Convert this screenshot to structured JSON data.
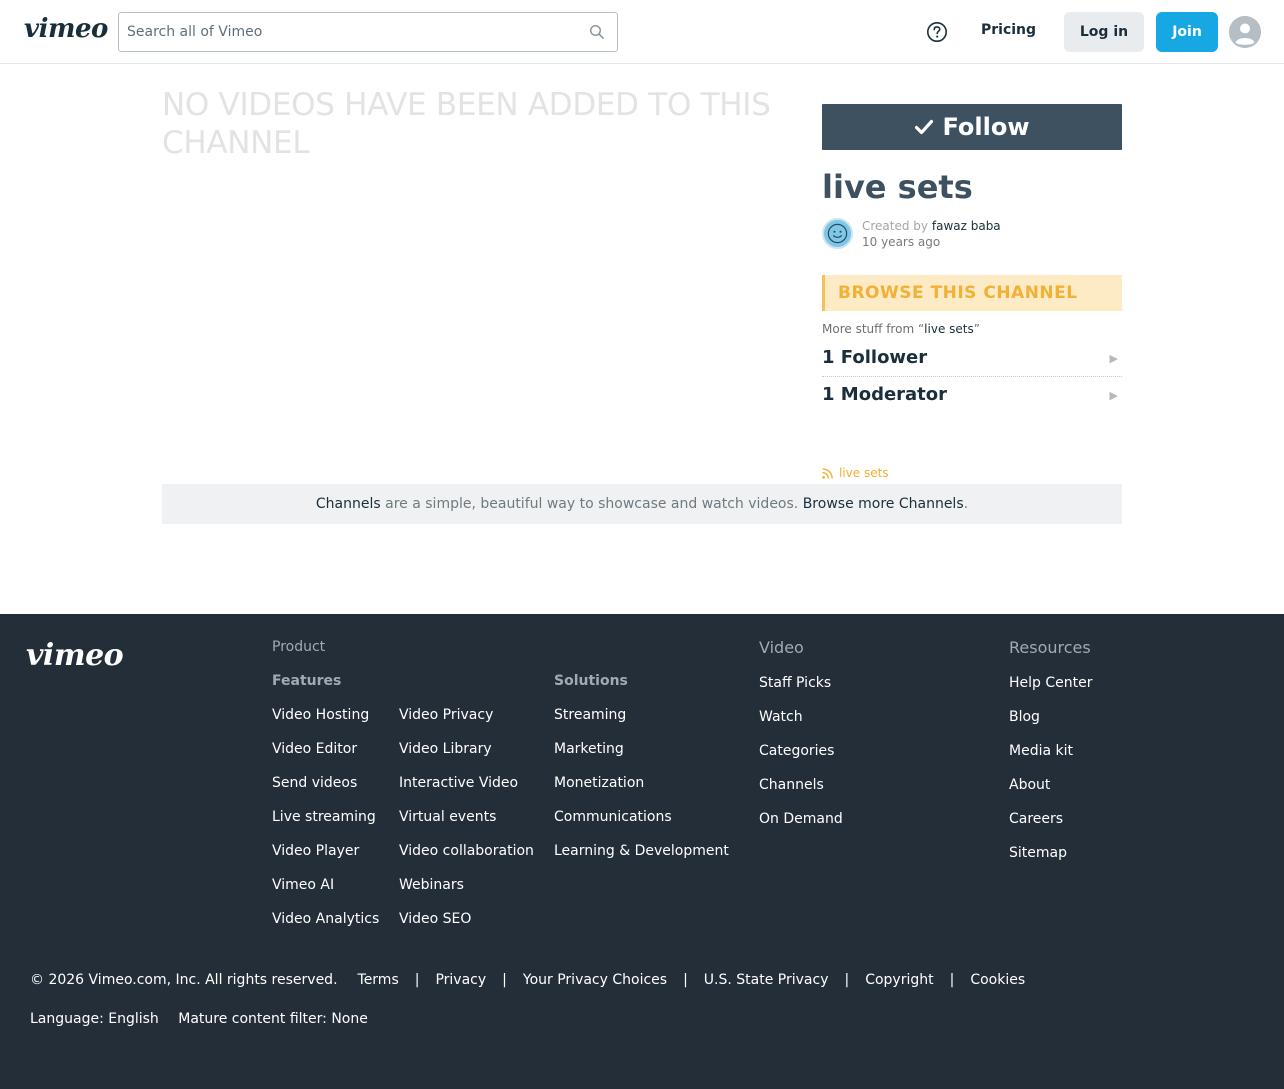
{
  "header": {
    "logo": "vimeo",
    "search_placeholder": "Search all of Vimeo",
    "pricing": "Pricing",
    "login": "Log in",
    "join": "Join"
  },
  "main": {
    "empty_message": "No videos have been added to this channel",
    "follow_label": "Follow",
    "channel_name": "live sets",
    "created_by_prefix": "Created by",
    "creator_name": "fawaz baba",
    "created_ago": "10 years ago",
    "browse_label": "BROWSE THIS CHANNEL",
    "more_stuff_prefix": "More stuff from “",
    "more_stuff_channel": "live sets",
    "more_stuff_suffix": "”",
    "followers": "1 Follower",
    "moderators": "1 Moderator",
    "rss_label": "live sets",
    "channels_bar": {
      "link1": "Channels",
      "text": " are a simple, beautiful way to showcase and watch videos. ",
      "link2": "Browse more Channels",
      "end": "."
    }
  },
  "footer": {
    "logo": "vimeo",
    "product_heading": "Product",
    "features_heading": "Features",
    "features_col1": [
      "Video Hosting",
      "Video Editor",
      "Send videos",
      "Live streaming",
      "Video Player",
      "Vimeo AI",
      "Video Analytics"
    ],
    "features_col2": [
      "Video Privacy",
      "Video Library",
      "Interactive Video",
      "Virtual events",
      "Video collaboration",
      "Webinars",
      "Video SEO"
    ],
    "solutions_heading": "Solutions",
    "solutions": [
      "Streaming",
      "Marketing",
      "Monetization",
      "Communications",
      "Learning & Development"
    ],
    "video_heading": "Video",
    "video": [
      "Staff Picks",
      "Watch",
      "Categories",
      "Channels",
      "On Demand"
    ],
    "resources_heading": "Resources",
    "resources": [
      "Help Center",
      "Blog",
      "Media kit",
      "About",
      "Careers",
      "Sitemap"
    ],
    "copyright": "© 2026 Vimeo.com, Inc. All rights reserved.",
    "legal_links": [
      "Terms",
      "Privacy",
      "Your Privacy Choices",
      "U.S. State Privacy",
      "Copyright",
      "Cookies"
    ],
    "language": "Language: English",
    "mature_filter": "Mature content filter: None"
  },
  "colors": {
    "follow_bg": "#3d5161",
    "join_bg": "#17a8e3",
    "browse_bg": "#fdebc5",
    "browse_text": "#f2b035",
    "footer_bg": "#232e39"
  },
  "icons": [
    "search-icon",
    "help-icon",
    "user-avatar-icon",
    "check-icon",
    "arrow-right-icon",
    "rss-icon"
  ]
}
